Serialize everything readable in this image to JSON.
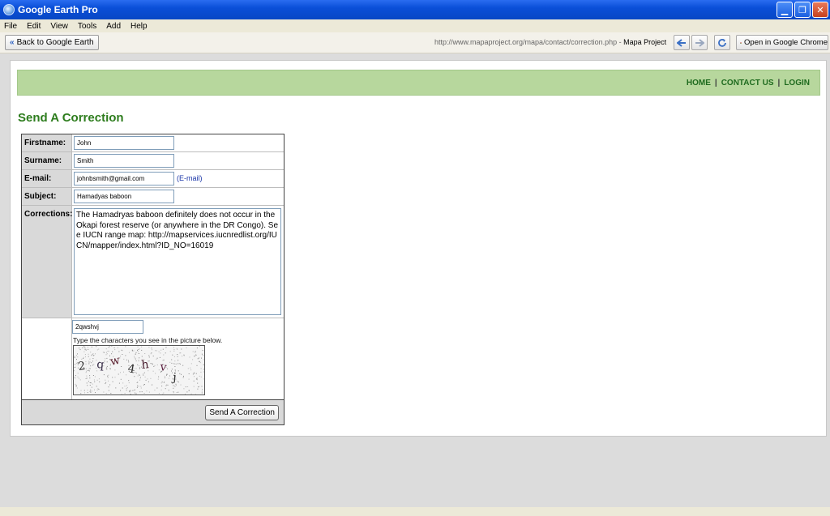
{
  "window": {
    "title": "Google Earth Pro"
  },
  "menu": [
    "File",
    "Edit",
    "View",
    "Tools",
    "Add",
    "Help"
  ],
  "toolbar": {
    "back_label": "Back to Google Earth",
    "url": "http://www.mapaproject.org/mapa/contact/correction.php",
    "url_separator": " - ",
    "page_title": "Mapa Project",
    "chrome_label": "Open in Google Chrome"
  },
  "nav": {
    "home": "HOME",
    "contact": "CONTACT US",
    "login": "LOGIN",
    "separator": "|"
  },
  "heading": "Send A Correction",
  "form": {
    "firstname_label": "Firstname:",
    "firstname_value": "John",
    "surname_label": "Surname:",
    "surname_value": "Smith",
    "email_label": "E-mail:",
    "email_value": "johnbsmith@gmail.com",
    "email_link": "(E-mail)",
    "subject_label": "Subject:",
    "subject_value": "Hamadyas baboon",
    "corrections_label": "Corrections:",
    "corrections_value": "The Hamadryas baboon definitely does not occur in the Okapi forest reserve (or anywhere in the DR Congo). See IUCN range map: http://mapservices.iucnredlist.org/IUCN/mapper/index.html?ID_NO=16019",
    "captcha_value": "2qwshvj",
    "captcha_instruction": "Type the characters you see in the picture below.",
    "captcha_chars": [
      "2",
      "q",
      "w",
      "4",
      "h",
      "v",
      "j"
    ],
    "submit_label": "Send A Correction"
  },
  "colors": {
    "heading": "#2e7d1e",
    "navbar": "#b7d79d",
    "titlebar": "#0a4fd8"
  }
}
